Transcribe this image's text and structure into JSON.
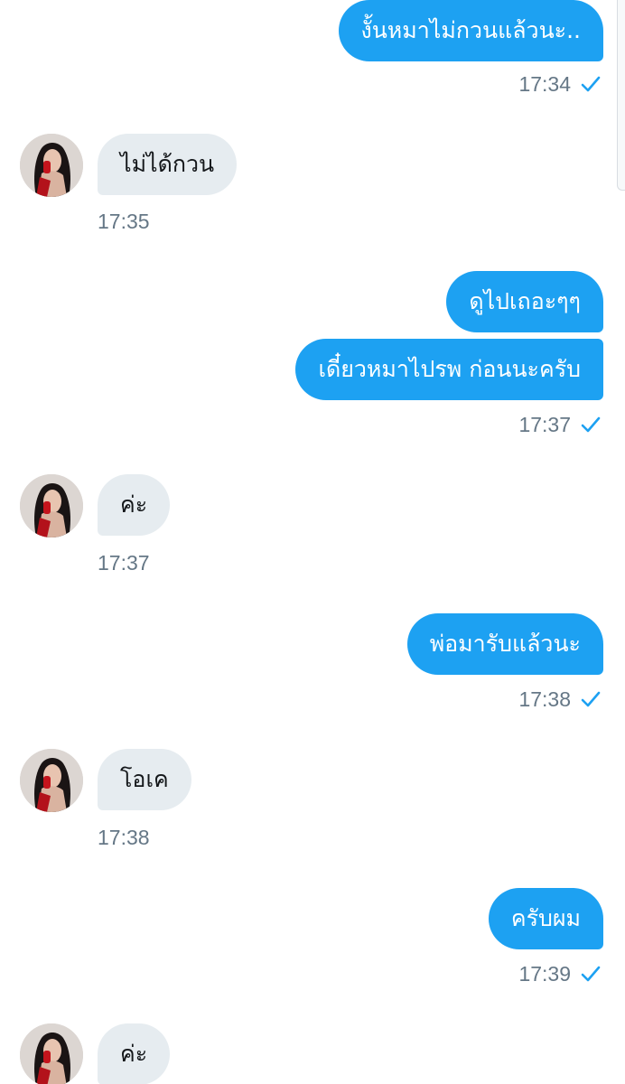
{
  "conversation": {
    "messages": [
      {
        "direction": "out",
        "text": "งั้นหมาไม่กวนแล้วนะ..",
        "time": "17:34",
        "status_icon": "check-icon"
      },
      {
        "direction": "in",
        "text": "ไม่ได้กวน",
        "time": "17:35",
        "avatar": "contact-avatar"
      },
      {
        "direction": "out",
        "text": "ดูไปเถอะๆๆ"
      },
      {
        "direction": "out",
        "text": "เดี๋ยวหมาไปรพ ก่อนนะครับ",
        "time": "17:37",
        "status_icon": "check-icon"
      },
      {
        "direction": "in",
        "text": "ค่ะ",
        "time": "17:37",
        "avatar": "contact-avatar"
      },
      {
        "direction": "out",
        "text": "พ่อมารับแล้วนะ",
        "time": "17:38",
        "status_icon": "check-icon"
      },
      {
        "direction": "in",
        "text": "โอเค",
        "time": "17:38",
        "avatar": "contact-avatar"
      },
      {
        "direction": "out",
        "text": "ครับผม",
        "time": "17:39",
        "status_icon": "check-icon"
      },
      {
        "direction": "in",
        "text": "ค่ะ",
        "avatar": "contact-avatar"
      }
    ]
  },
  "colors": {
    "outgoing_bubble": "#1da1f2",
    "incoming_bubble": "#e6ecf0",
    "timestamp": "#657786",
    "read_check": "#1da1f2"
  }
}
